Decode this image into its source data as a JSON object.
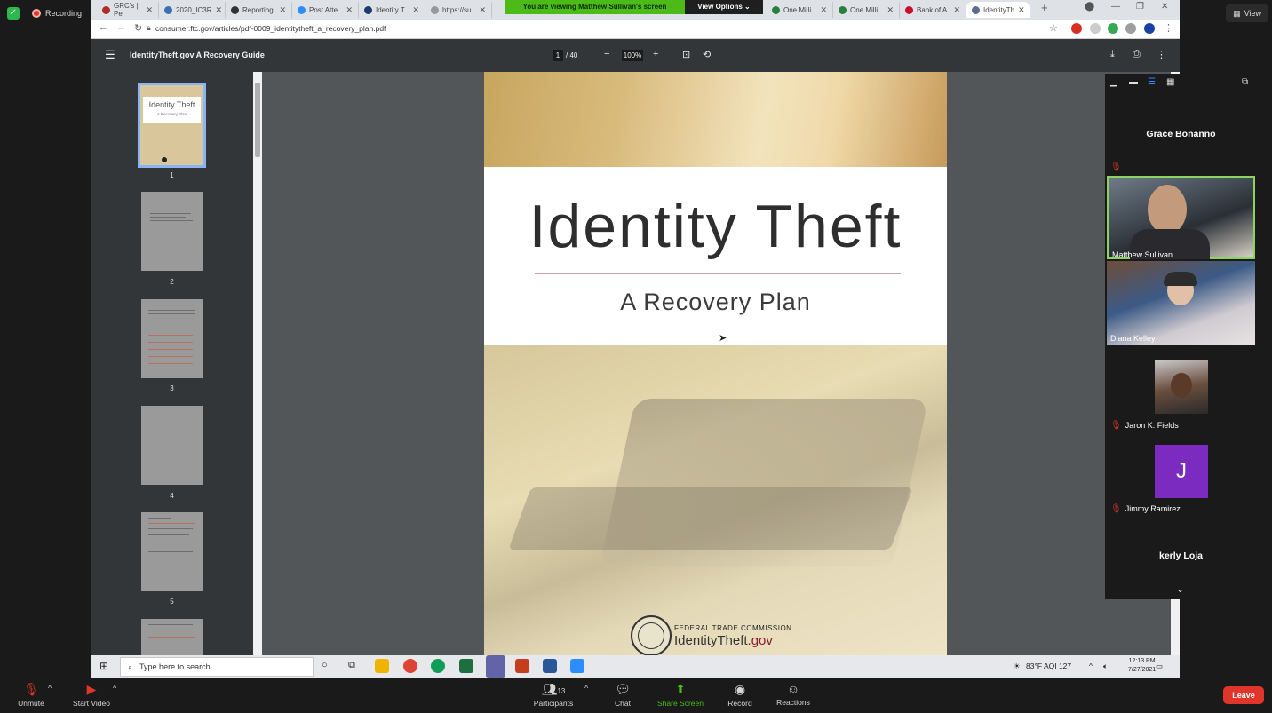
{
  "zoom": {
    "recording_label": "Recording",
    "view_label": "View",
    "banner": "You are viewing Matthew Sullivan's screen",
    "view_options": "View Options",
    "controls": {
      "unmute": "Unmute",
      "start_video": "Start Video",
      "participants": "Participants",
      "participants_count": "13",
      "chat": "Chat",
      "share_screen": "Share Screen",
      "record": "Record",
      "reactions": "Reactions",
      "leave": "Leave"
    }
  },
  "browser": {
    "tabs": [
      "GRC's | Pe",
      "2020_IC3R",
      "Reporting",
      "Post Atte",
      "Identity T",
      "https://su",
      "One Milli",
      "One Milli",
      "Bank of A",
      "IdentityTh"
    ],
    "url": "consumer.ftc.gov/articles/pdf-0009_identitytheft_a_recovery_plan.pdf"
  },
  "pdf": {
    "title": "IdentityTheft.gov A Recovery Guide",
    "page_current": "1",
    "page_total": "/ 40",
    "zoom": "100%",
    "thumbnails": [
      "1",
      "2",
      "3",
      "4",
      "5"
    ],
    "page": {
      "title": "Identity Theft",
      "subtitle": "A Recovery Plan",
      "agency": "FEDERAL TRADE COMMISSION",
      "site_prefix": "IdentityTheft",
      "site_suffix": ".gov",
      "thumb_title": "Identity Theft",
      "thumb_subtitle": "A Recovery Plan"
    }
  },
  "participants": [
    {
      "name": "Grace Bonanno",
      "type": "name-only",
      "muted": true
    },
    {
      "name": "Matthew Sullivan",
      "type": "video",
      "muted": false
    },
    {
      "name": "Diana Kelley",
      "type": "video",
      "muted": false
    },
    {
      "name": "Jaron K. Fields",
      "type": "photo",
      "muted": true
    },
    {
      "name": "Jimmy Ramirez",
      "type": "initial",
      "initial": "J",
      "muted": true
    },
    {
      "name": "kerly Loja",
      "type": "name-only",
      "muted": false
    }
  ],
  "taskbar": {
    "search_placeholder": "Type here to search",
    "weather": "83°F  AQI 127",
    "time": "12:13 PM",
    "date": "7/27/2021"
  },
  "colors": {
    "zoom_green": "#4cbb17",
    "leave_red": "#e0352b",
    "pdf_toolbar": "#323639",
    "pdf_background": "#525659"
  }
}
